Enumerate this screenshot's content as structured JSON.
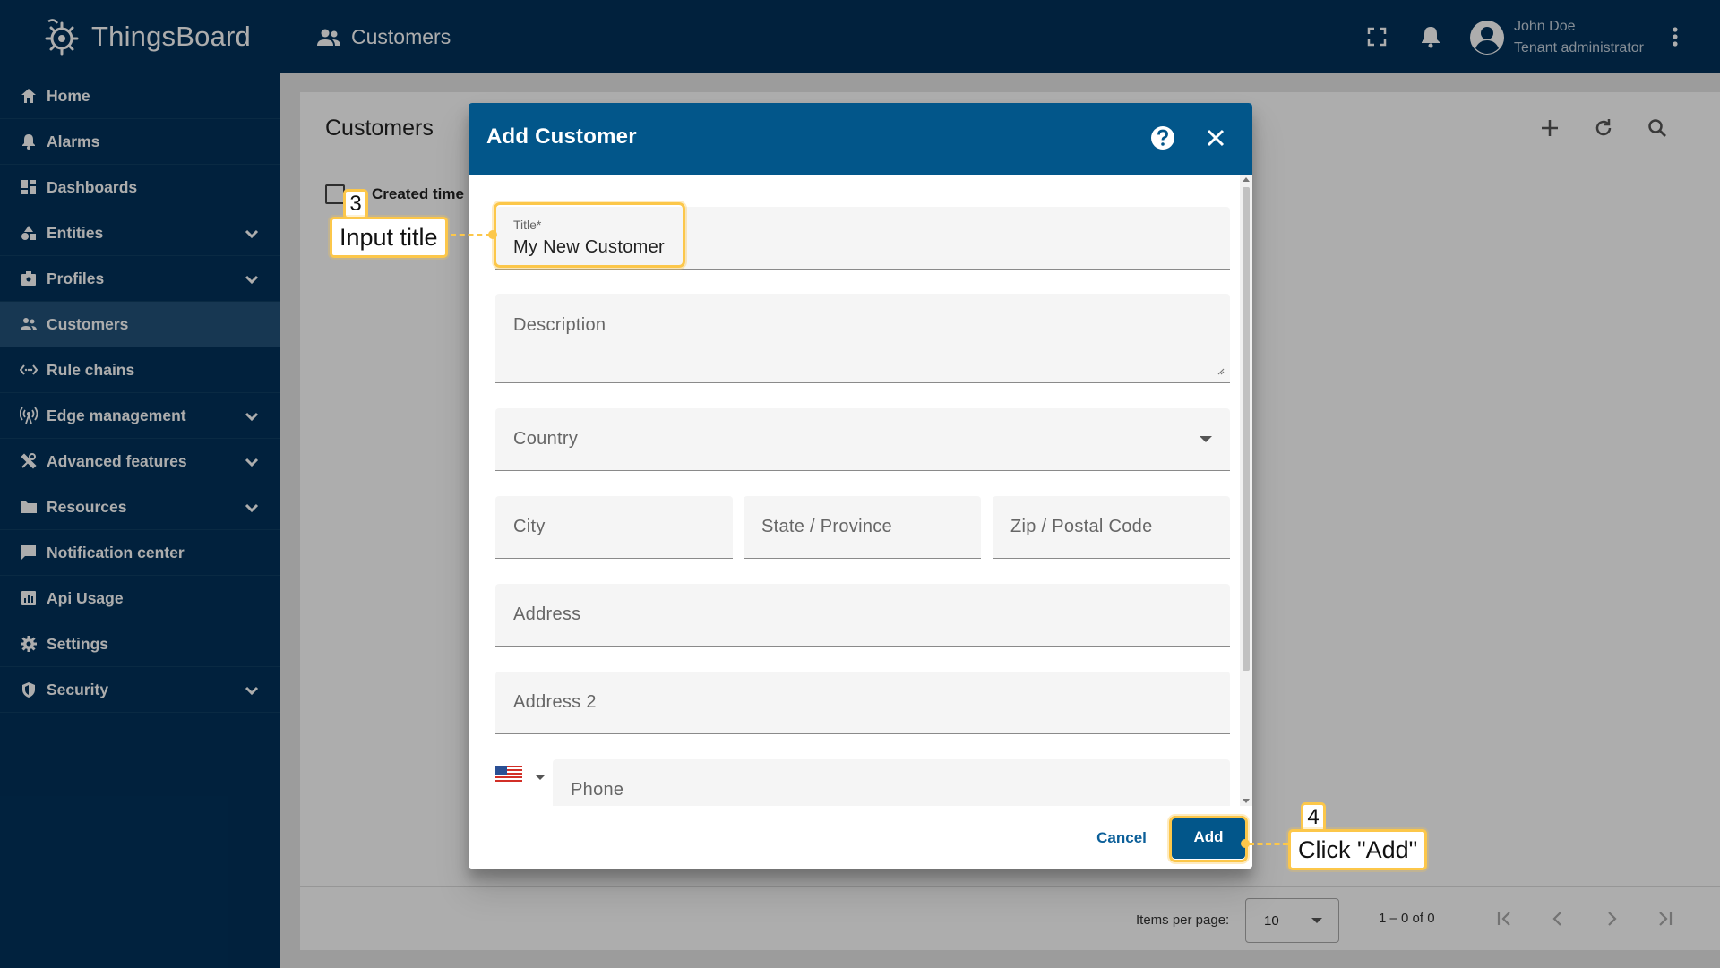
{
  "app": {
    "logo_text": "ThingsBoard",
    "page_title": "Customers"
  },
  "user": {
    "name": "John Doe",
    "role": "Tenant administrator"
  },
  "sidebar": {
    "items": [
      {
        "label": "Home",
        "icon": "home-icon",
        "chevron": false,
        "active": false
      },
      {
        "label": "Alarms",
        "icon": "bell-icon",
        "chevron": false,
        "active": false
      },
      {
        "label": "Dashboards",
        "icon": "dashboard-icon",
        "chevron": false,
        "active": false
      },
      {
        "label": "Entities",
        "icon": "entities-icon",
        "chevron": true,
        "active": false
      },
      {
        "label": "Profiles",
        "icon": "profiles-icon",
        "chevron": true,
        "active": false
      },
      {
        "label": "Customers",
        "icon": "customers-icon",
        "chevron": false,
        "active": true
      },
      {
        "label": "Rule chains",
        "icon": "rule-chains-icon",
        "chevron": false,
        "active": false
      },
      {
        "label": "Edge management",
        "icon": "edge-icon",
        "chevron": true,
        "active": false
      },
      {
        "label": "Advanced features",
        "icon": "tools-icon",
        "chevron": true,
        "active": false
      },
      {
        "label": "Resources",
        "icon": "folder-icon",
        "chevron": true,
        "active": false
      },
      {
        "label": "Notification center",
        "icon": "notification-icon",
        "chevron": false,
        "active": false
      },
      {
        "label": "Api Usage",
        "icon": "api-usage-icon",
        "chevron": false,
        "active": false
      },
      {
        "label": "Settings",
        "icon": "gear-icon",
        "chevron": false,
        "active": false
      },
      {
        "label": "Security",
        "icon": "shield-icon",
        "chevron": true,
        "active": false
      }
    ]
  },
  "main": {
    "title": "Customers",
    "column_created_time": "Created time",
    "paginator": {
      "items_per_page_label": "Items per page:",
      "items_per_page_value": "10",
      "range_label": "1 – 0 of 0"
    }
  },
  "dialog": {
    "title": "Add Customer",
    "fields": {
      "title_label": "Title*",
      "title_value": "My New Customer",
      "description_placeholder": "Description",
      "country_placeholder": "Country",
      "city_placeholder": "City",
      "state_placeholder": "State / Province",
      "zip_placeholder": "Zip / Postal Code",
      "address_placeholder": "Address",
      "address2_placeholder": "Address 2",
      "phone_placeholder": "Phone"
    },
    "cancel_label": "Cancel",
    "add_label": "Add"
  },
  "annotations": {
    "step3_number": "3",
    "step3_text": "Input title",
    "step4_number": "4",
    "step4_text": "Click \"Add\"",
    "color": "#fcc74a"
  },
  "colors": {
    "topbar": "#02325b",
    "sidebar_active": "#23517a",
    "dialog_header": "#02568a",
    "accent_button": "#02568a"
  }
}
